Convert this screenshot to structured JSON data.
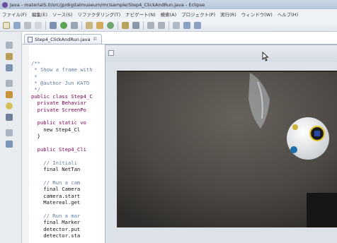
{
  "window": {
    "title": "Java - materialS.0/src/jp/digitalmuseum/mr/sample/Step4_ClickAndRun.java - Eclipse"
  },
  "menubar": {
    "items": [
      "ファイル(F)",
      "編集(E)",
      "ソース(S)",
      "リファクタリング(T)",
      "ナビゲート(N)",
      "検索(A)",
      "プロジェクト(P)",
      "実行(R)",
      "ウィンドウ(W)",
      "ヘルプ(H)"
    ]
  },
  "editor": {
    "tab_label": "Step4_ClickAndRun.java",
    "tab_close": "☒",
    "code_lines": [
      {
        "text": "",
        "kind": "plain"
      },
      {
        "text": "",
        "kind": "plain"
      },
      {
        "text": "/**",
        "kind": "comment"
      },
      {
        "text": " * Show a frame with",
        "kind": "comment"
      },
      {
        "text": " *",
        "kind": "comment"
      },
      {
        "text": " * @author Jun KATO",
        "kind": "comment"
      },
      {
        "text": " */",
        "kind": "comment"
      },
      {
        "text": "public class Step4_C",
        "kind": "kw"
      },
      {
        "text": "  private Behavior",
        "kind": "kw"
      },
      {
        "text": "  private ScreenPo",
        "kind": "kw"
      },
      {
        "text": "",
        "kind": "plain"
      },
      {
        "text": "  public static vo",
        "kind": "kw"
      },
      {
        "text": "    new Step4_Cl",
        "kind": "plain"
      },
      {
        "text": "  }",
        "kind": "plain"
      },
      {
        "text": "",
        "kind": "plain"
      },
      {
        "text": "  public Step4_Cli",
        "kind": "kw"
      },
      {
        "text": "",
        "kind": "plain"
      },
      {
        "text": "    // Initiali",
        "kind": "comment"
      },
      {
        "text": "    final NetTan",
        "kind": "plain"
      },
      {
        "text": "",
        "kind": "plain"
      },
      {
        "text": "    // Run a cam",
        "kind": "comment"
      },
      {
        "text": "    final Camera",
        "kind": "plain"
      },
      {
        "text": "    camera.start",
        "kind": "plain"
      },
      {
        "text": "    Matereal.get",
        "kind": "plain"
      },
      {
        "text": "",
        "kind": "plain"
      },
      {
        "text": "    // Run a mar",
        "kind": "comment"
      },
      {
        "text": "    final Marker",
        "kind": "plain"
      },
      {
        "text": "    detector.put",
        "kind": "plain"
      },
      {
        "text": "    detector.sta",
        "kind": "plain"
      }
    ]
  },
  "colors": {
    "comment": "#5f7f9f",
    "keyword": "#7f0055",
    "window_accent": "#b4c5da"
  }
}
